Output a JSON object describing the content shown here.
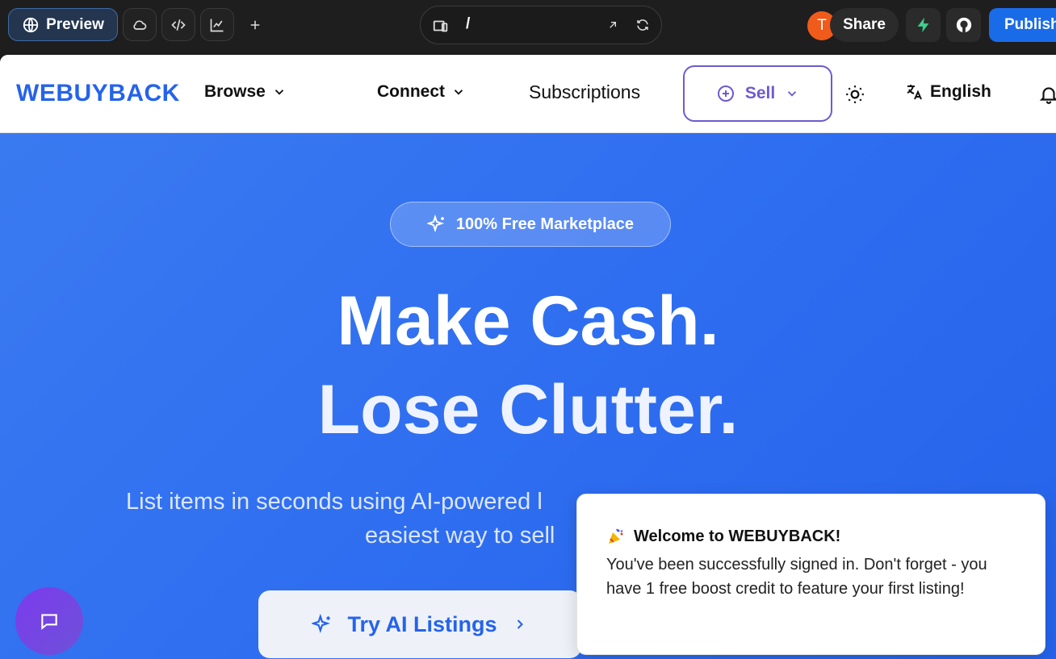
{
  "toolbar": {
    "preview_label": "Preview",
    "url_path": "/",
    "avatar_initial": "T",
    "share_label": "Share",
    "publish_label": "Publish"
  },
  "nav": {
    "logo": "WEBUYBACK",
    "browse": "Browse",
    "connect": "Connect",
    "subscriptions": "Subscriptions",
    "sell": "Sell",
    "language": "English"
  },
  "hero": {
    "badge": "100% Free Marketplace",
    "headline_1": "Make Cash.",
    "headline_2": "Lose Clutter.",
    "subtitle_1": "List items in seconds using AI-powered l",
    "subtitle_2": "easiest way to sell",
    "cta": "Try AI Listings"
  },
  "toast": {
    "icon": "party-popper-icon",
    "title": "Welcome to WEBUYBACK!",
    "body": "You've been successfully signed in. Don't forget - you have 1 free boost credit to feature your first listing!"
  },
  "colors": {
    "brand": "#2563eb",
    "sell_accent": "#6d5bd0",
    "publish": "#1a6be8"
  }
}
